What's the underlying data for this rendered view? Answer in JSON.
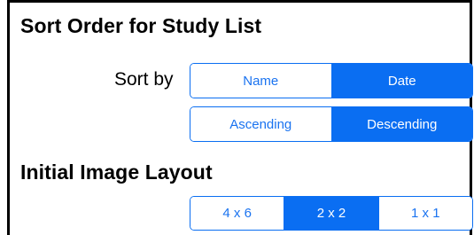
{
  "sort_section": {
    "title": "Sort Order for Study List",
    "sort_by_label": "Sort by",
    "sort_by_options": [
      {
        "label": "Name",
        "selected": false
      },
      {
        "label": "Date",
        "selected": true
      }
    ],
    "order_options": [
      {
        "label": "Ascending",
        "selected": false
      },
      {
        "label": "Descending",
        "selected": true
      }
    ]
  },
  "layout_section": {
    "title": "Initial Image Layout",
    "layout_options": [
      {
        "label": "4 x 6",
        "selected": false
      },
      {
        "label": "2 x 2",
        "selected": true
      },
      {
        "label": "1 x 1",
        "selected": false
      }
    ]
  },
  "colors": {
    "accent": "#0a6ef2",
    "accent_text": "#1a73f0",
    "background": "#ffffff"
  }
}
